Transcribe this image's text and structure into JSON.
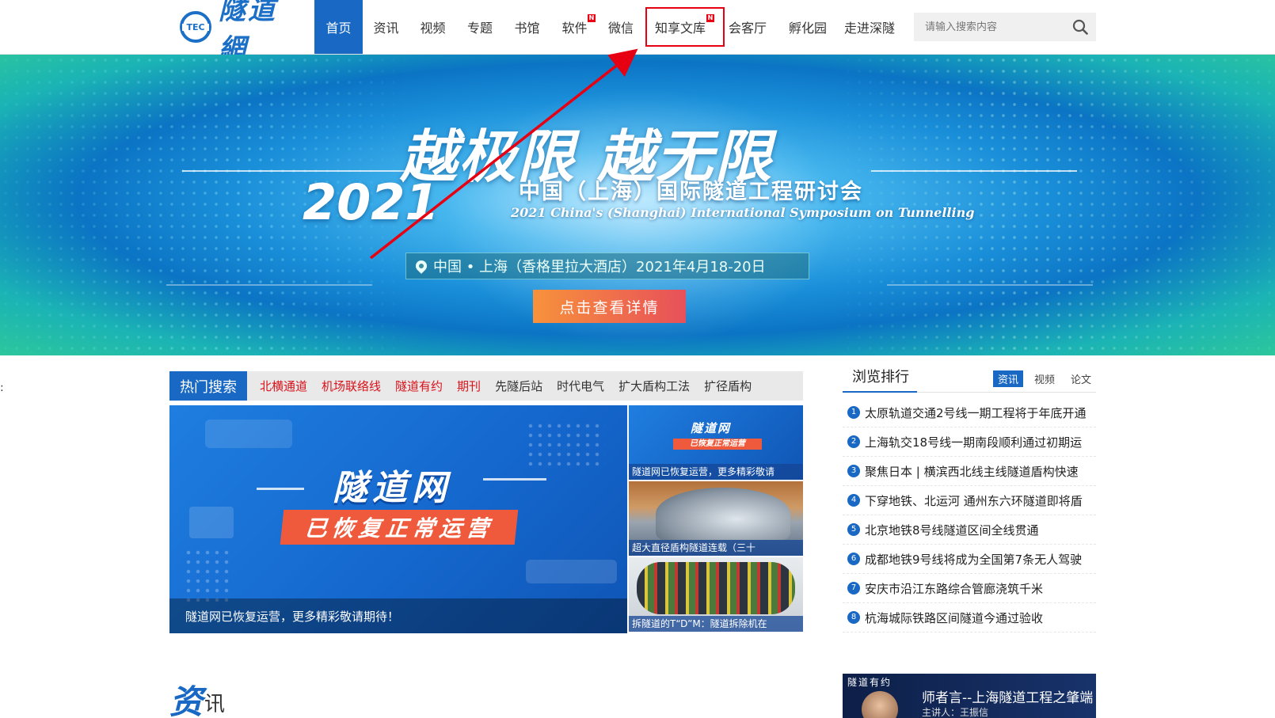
{
  "header": {
    "logo_text": "隧道網",
    "logo_mark": "TEC",
    "nav": [
      {
        "label": "首页",
        "active": true,
        "new": false
      },
      {
        "label": "资讯",
        "active": false,
        "new": false
      },
      {
        "label": "视频",
        "active": false,
        "new": false
      },
      {
        "label": "专题",
        "active": false,
        "new": false
      },
      {
        "label": "书馆",
        "active": false,
        "new": false
      },
      {
        "label": "软件",
        "active": false,
        "new": true
      },
      {
        "label": "微信",
        "active": false,
        "new": false
      },
      {
        "label": "知享文库",
        "active": false,
        "new": true
      },
      {
        "label": "会客厅",
        "active": false,
        "new": false
      },
      {
        "label": "孵化园",
        "active": false,
        "new": false
      },
      {
        "label": "走进深隧",
        "active": false,
        "new": false
      }
    ],
    "new_badge": "N",
    "search_placeholder": "请输入搜索内容"
  },
  "banner": {
    "slogan": "越极限 越无限",
    "year": "2021",
    "conference_cn": "中国（上海）国际隧道工程研讨会",
    "conference_en": "2021 China's (Shanghai) International Symposium on Tunnelling",
    "place": "中国 • 上海（香格里拉大酒店）2021年4月18-20日",
    "button": "点击查看详情"
  },
  "side_mark": ":",
  "hot_search": {
    "label": "热门搜索",
    "items": [
      {
        "text": "北横通道",
        "color": "red"
      },
      {
        "text": "机场联络线",
        "color": "red"
      },
      {
        "text": "隧道有约",
        "color": "red"
      },
      {
        "text": "期刊",
        "color": "red"
      },
      {
        "text": "先隧后站",
        "color": "dark"
      },
      {
        "text": "时代电气",
        "color": "dark"
      },
      {
        "text": "扩大盾构工法",
        "color": "dark"
      },
      {
        "text": "扩径盾构",
        "color": "dark"
      }
    ]
  },
  "feature": {
    "title": "隧道网",
    "tag": "已恢复正常运营",
    "caption": "隧道网已恢复运营，更多精彩敬请期待！"
  },
  "thumbs": [
    {
      "title": "隧道网",
      "sub": "已恢复正常运营",
      "caption": "隧道网已恢复运营，更多精彩敬请"
    },
    {
      "caption": "超大直径盾构隧道连载（三十"
    },
    {
      "caption": "拆隧道的T“D”M：隧道拆除机在"
    }
  ],
  "ranking": {
    "title": "浏览排行",
    "tabs": [
      {
        "label": "资讯",
        "active": true
      },
      {
        "label": "视频",
        "active": false
      },
      {
        "label": "论文",
        "active": false
      }
    ],
    "items": [
      {
        "num": "1",
        "text": "太原轨道交通2号线一期工程将于年底开通"
      },
      {
        "num": "2",
        "text": "上海轨交18号线一期南段顺利通过初期运"
      },
      {
        "num": "3",
        "text": "聚焦日本 | 横滨西北线主线隧道盾构快速"
      },
      {
        "num": "4",
        "text": "下穿地铁、北运河 通州东六环隧道即将盾"
      },
      {
        "num": "5",
        "text": "北京地铁8号线隧道区间全线贯通"
      },
      {
        "num": "6",
        "text": "成都地铁9号线将成为全国第7条无人驾驶"
      },
      {
        "num": "7",
        "text": "安庆市沿江东路综合管廊浇筑千米"
      },
      {
        "num": "8",
        "text": "杭海城际铁路区间隧道今通过验收"
      }
    ]
  },
  "section": {
    "big": "资",
    "small": "讯"
  },
  "promo": {
    "tag": "隧道有约",
    "title": "师者言--上海隧道工程之肇端",
    "sub": "主讲人：王振信"
  },
  "colors": {
    "brand_blue": "#1868c4",
    "hot_red": "#d9121b",
    "annotation_red": "#e60012",
    "button_orange": "#f7923b"
  }
}
